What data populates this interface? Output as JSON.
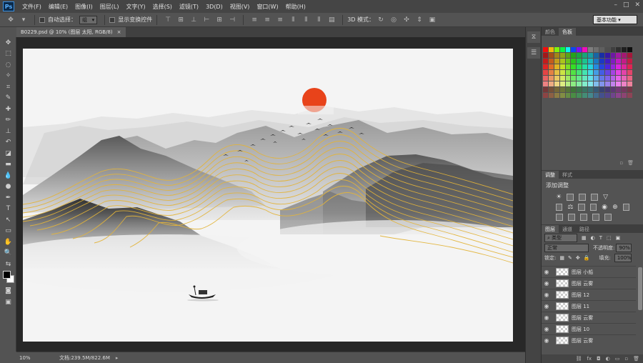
{
  "menubar": {
    "logo": "Ps",
    "items": [
      "文件(F)",
      "编辑(E)",
      "图像(I)",
      "图层(L)",
      "文字(Y)",
      "选择(S)",
      "滤镜(T)",
      "3D(D)",
      "视图(V)",
      "窗口(W)",
      "帮助(H)"
    ]
  },
  "options": {
    "auto_select_label": "自动选择：",
    "auto_select_value": "组",
    "show_transform_label": "显示变换控件",
    "mode_3d_label": "3D 模式：",
    "workspace": "基本功能"
  },
  "document": {
    "tab_title": "B0229.psd @ 10% (图层 太阳, RGB/8)",
    "close_glyph": "×"
  },
  "status": {
    "zoom": "10%",
    "doc_info": "文档:239.5M/822.6M"
  },
  "panels": {
    "color_tabs": [
      "颜色",
      "色板"
    ],
    "adjust_tabs": [
      "调整",
      "样式"
    ],
    "adjust_title": "添加调整",
    "layers_tabs": [
      "图层",
      "通道",
      "路径"
    ],
    "filter_kind": "类型",
    "blend_mode": "正常",
    "opacity_label": "不透明度:",
    "opacity_value": "90%",
    "lock_label": "锁定:",
    "fill_label": "填充:",
    "fill_value": "100%",
    "layers": [
      "图层 小船",
      "图层 云雾",
      "图层 12",
      "图层 11",
      "图层 云雾",
      "图层 10",
      "图层 云雾"
    ]
  },
  "colors": {
    "accent_sun": "#e8431a",
    "gold": "#e3b43a"
  }
}
